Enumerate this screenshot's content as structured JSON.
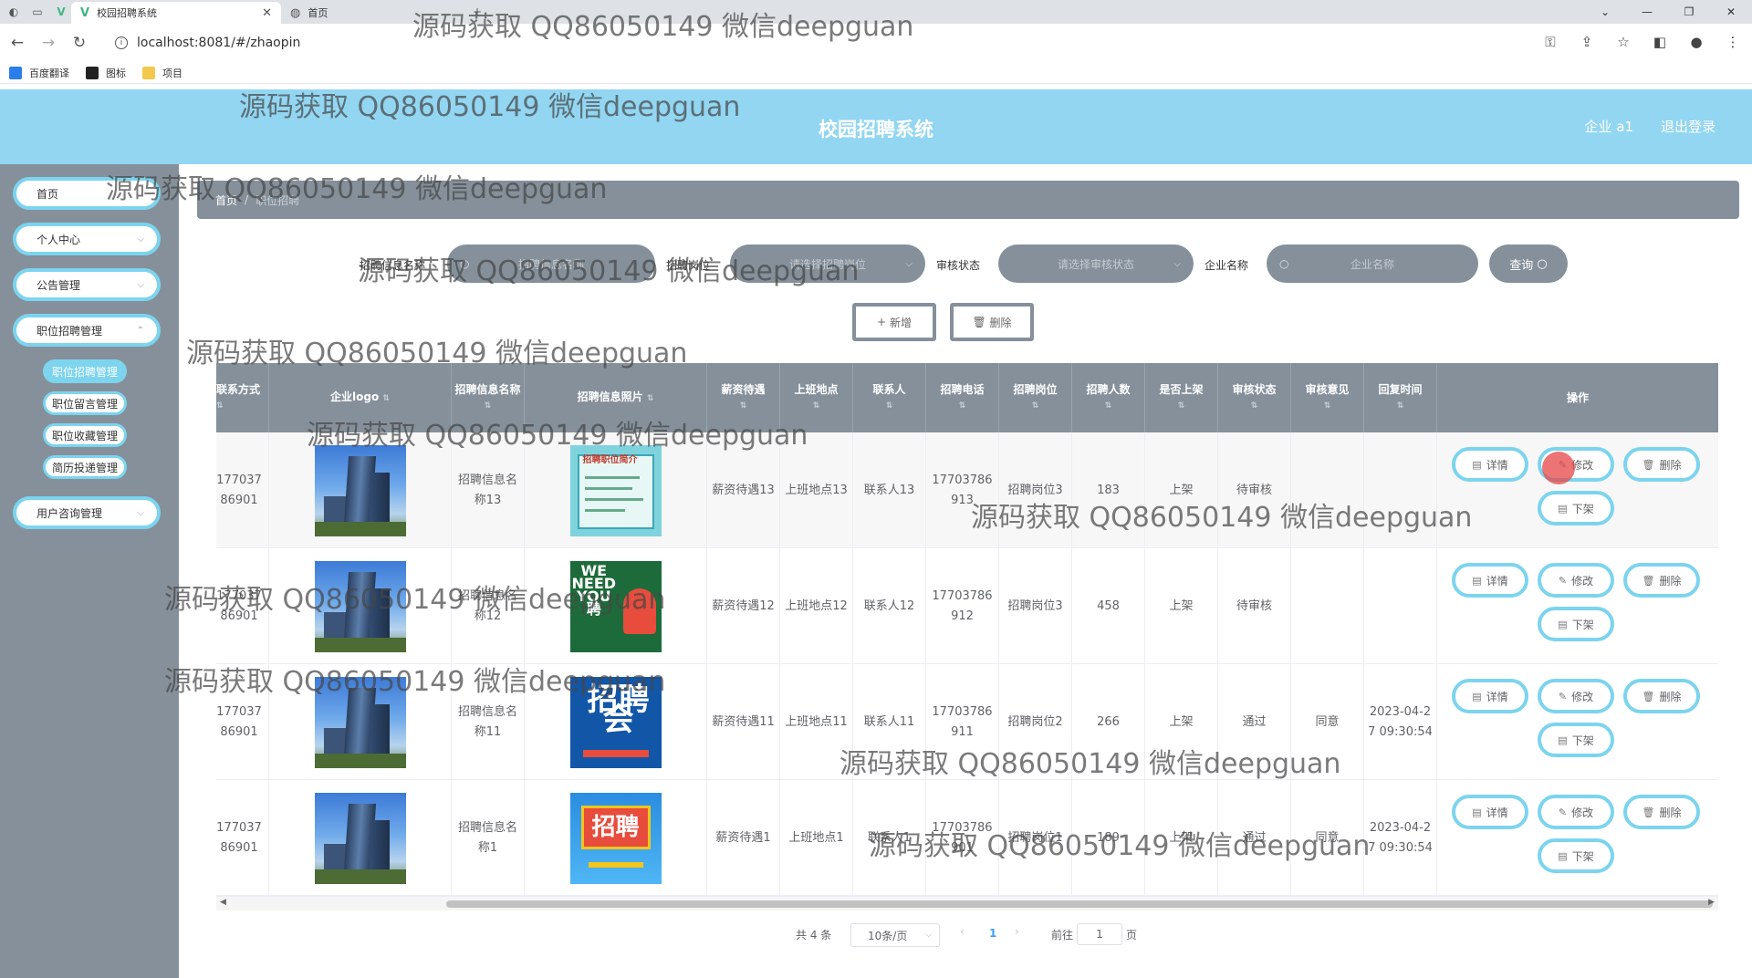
{
  "browser": {
    "tabs": [
      {
        "label": "校园招聘系统",
        "active": true
      },
      {
        "label": "首页",
        "active": false
      }
    ],
    "url": "localhost:8081/#/zhaopin",
    "bookmarks": [
      "百度翻译",
      "图标",
      "项目"
    ]
  },
  "header": {
    "title": "校园招聘系统",
    "user": "企业 a1",
    "logout": "退出登录"
  },
  "sidebar": {
    "items": [
      {
        "label": "首页"
      },
      {
        "label": "个人中心"
      },
      {
        "label": "公告管理"
      },
      {
        "label": "职位招聘管理"
      },
      {
        "label": "用户咨询管理"
      }
    ],
    "subitems": [
      {
        "label": "职位招聘管理",
        "active": true
      },
      {
        "label": "职位留言管理"
      },
      {
        "label": "职位收藏管理"
      },
      {
        "label": "简历投递管理"
      }
    ]
  },
  "breadcrumb": {
    "home": "首页",
    "current": "职位招聘"
  },
  "filters": {
    "name_label": "招聘信息名称",
    "name_placeholder": "招聘信息名称",
    "position_label": "招聘岗位",
    "position_placeholder": "请选择招聘岗位",
    "status_label": "审核状态",
    "status_placeholder": "请选择审核状态",
    "company_label": "企业名称",
    "company_placeholder": "企业名称",
    "query_button": "查询"
  },
  "actions": {
    "add": "新增",
    "delete": "删除"
  },
  "table": {
    "columns": [
      "联系方式",
      "企业logo",
      "招聘信息名称",
      "招聘信息照片",
      "薪资待遇",
      "上班地点",
      "联系人",
      "招聘电话",
      "招聘岗位",
      "招聘人数",
      "是否上架",
      "审核状态",
      "审核意见",
      "回复时间",
      "操作"
    ],
    "rows": [
      {
        "contact": "17703786901",
        "name": "招聘信息名称13",
        "salary": "薪资待遇13",
        "location": "上班地点13",
        "person": "联系人13",
        "phone": "17703786913",
        "position": "招聘岗位3",
        "count": "183",
        "listed": "上架",
        "status": "待审核",
        "opinion": "",
        "reply": ""
      },
      {
        "contact": "17703786901",
        "name": "招聘信息名称12",
        "salary": "薪资待遇12",
        "location": "上班地点12",
        "person": "联系人12",
        "phone": "17703786912",
        "position": "招聘岗位3",
        "count": "458",
        "listed": "上架",
        "status": "待审核",
        "opinion": "",
        "reply": ""
      },
      {
        "contact": "17703786901",
        "name": "招聘信息名称11",
        "salary": "薪资待遇11",
        "location": "上班地点11",
        "person": "联系人11",
        "phone": "17703786911",
        "position": "招聘岗位2",
        "count": "266",
        "listed": "上架",
        "status": "通过",
        "opinion": "同意",
        "reply": "2023-04-27 09:30:54"
      },
      {
        "contact": "17703786901",
        "name": "招聘信息名称1",
        "salary": "薪资待遇1",
        "location": "上班地点1",
        "person": "联系人1",
        "phone": "17703786901",
        "position": "招聘岗位1",
        "count": "189",
        "listed": "上架",
        "status": "通过",
        "opinion": "同意",
        "reply": "2023-04-27 09:30:54"
      }
    ],
    "ops": {
      "detail": "详情",
      "edit": "修改",
      "delete": "删除",
      "unlist": "下架"
    }
  },
  "pagination": {
    "total": "共 4 条",
    "page_size": "10条/页",
    "current_page": "1",
    "goto_label": "前往",
    "goto_value": "1",
    "page_suffix": "页"
  },
  "watermark": "源码获取 QQ86050149 微信deepguan",
  "colors": {
    "header": "#92d6f2",
    "sidebar": "#85909b",
    "accent": "#7cd4ee"
  }
}
